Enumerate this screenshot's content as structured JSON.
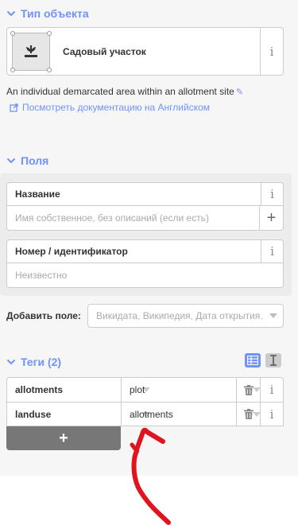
{
  "preset_section": {
    "title": "Тип объекта"
  },
  "preset": {
    "name": "Садовый участок",
    "icon": "garden-plot-icon",
    "info_label": "i",
    "description": "An individual demarcated area within an allotment site",
    "doc_link": "Посмотреть документацию на Английском"
  },
  "fields_section": {
    "title": "Поля"
  },
  "fields": [
    {
      "label": "Название",
      "value": "",
      "placeholder": "Имя собственное, без описаний (если есть)",
      "info_label": "i",
      "add_label": "+"
    },
    {
      "label": "Номер / идентификатор",
      "value": "",
      "placeholder": "Неизвестно",
      "info_label": "i"
    }
  ],
  "add_field": {
    "label": "Добавить поле:",
    "placeholder": "Викидата, Википедия, Дата открытия…"
  },
  "tags_section": {
    "title": "Теги (2)"
  },
  "tags": [
    {
      "key": "allotments",
      "value": "plot",
      "info_label": "i"
    },
    {
      "key": "landuse",
      "value": "allotments",
      "info_label": "i"
    }
  ],
  "add_tag_label": "+",
  "colors": {
    "accent": "#7092ff",
    "annotation": "#e0141e",
    "add_button": "#777777"
  }
}
